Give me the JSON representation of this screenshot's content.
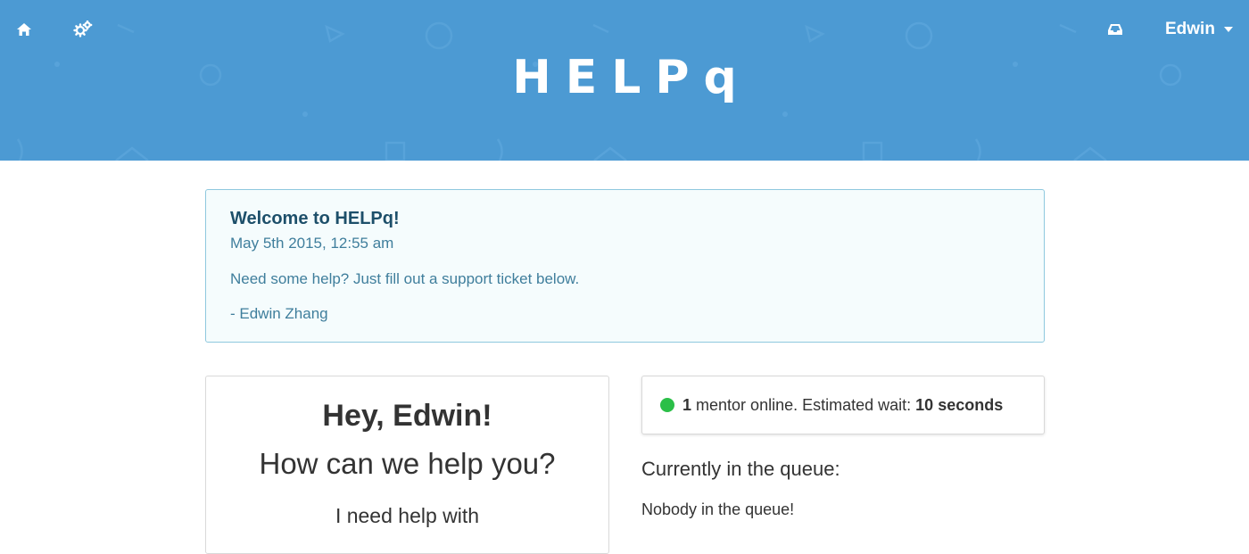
{
  "header": {
    "brand": "HELPq",
    "background_color": "#4c9ad3",
    "nav_icons": [
      "home-icon",
      "cogs-icon",
      "inbox-icon"
    ],
    "user": {
      "name": "Edwin"
    }
  },
  "announcement": {
    "title": "Welcome to HELPq!",
    "date": "May 5th 2015, 12:55 am",
    "body": "Need some help? Just fill out a support ticket below.",
    "signature": "- Edwin Zhang"
  },
  "help_card": {
    "greeting": "Hey, Edwin!",
    "question": "How can we help you?",
    "need_help_label": "I need help with"
  },
  "status": {
    "mentor_count": "1",
    "mentor_text": "mentor online. Estimated wait:",
    "wait_time": "10 seconds",
    "online_color": "#2bbf48"
  },
  "queue": {
    "heading": "Currently in the queue:",
    "empty_message": "Nobody in the queue!"
  }
}
